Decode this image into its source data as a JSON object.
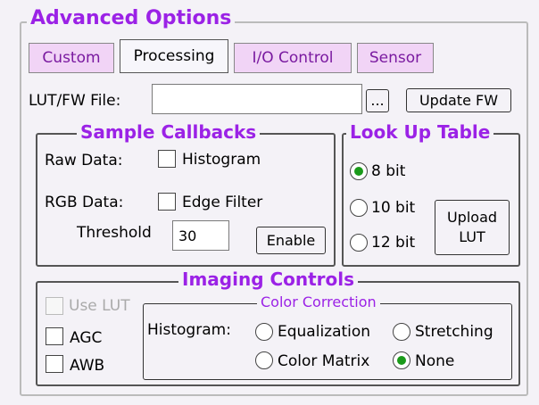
{
  "panel": {
    "title": "Advanced Options"
  },
  "tabs": [
    {
      "label": "Custom",
      "active": false
    },
    {
      "label": "Processing",
      "active": true
    },
    {
      "label": "I/O Control",
      "active": false
    },
    {
      "label": "Sensor",
      "active": false
    }
  ],
  "lut": {
    "file_label": "LUT/FW File:",
    "file_value": "",
    "browse_label": "...",
    "update_label": "Update FW"
  },
  "callbacks": {
    "title": "Sample Callbacks",
    "raw_label": "Raw Data:",
    "histogram_label": "Histogram",
    "histogram_checked": false,
    "rgb_label": "RGB Data:",
    "edge_label": "Edge Filter",
    "edge_checked": false,
    "threshold_label": "Threshold",
    "threshold_value": "30",
    "enable_label": "Enable"
  },
  "lookup": {
    "title": "Look Up Table",
    "options": [
      "8 bit",
      "10 bit",
      "12 bit"
    ],
    "selected": "8 bit",
    "upload_line1": "Upload",
    "upload_line2": "LUT"
  },
  "imaging": {
    "title": "Imaging Controls",
    "use_lut_label": "Use LUT",
    "use_lut_enabled": false,
    "agc_label": "AGC",
    "awb_label": "AWB",
    "color_correction": {
      "title": "Color Correction",
      "histogram_label": "Histogram:",
      "options": [
        "Equalization",
        "Stretching",
        "Color Matrix",
        "None"
      ],
      "selected": "None"
    }
  },
  "colors": {
    "accent": "#9b22e6",
    "tab_bg": "#f1d4f6",
    "radio_dot": "#1a9a1a"
  }
}
